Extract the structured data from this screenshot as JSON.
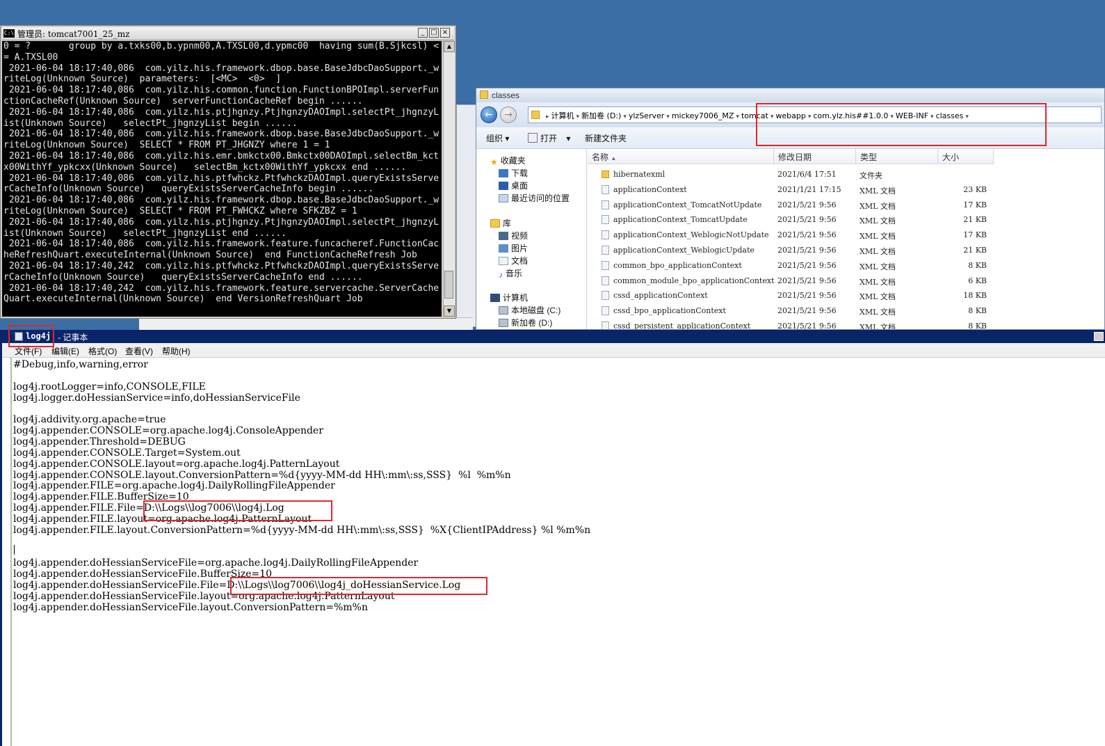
{
  "cmd": {
    "title": "管理员:  tomcat7001_25_mz",
    "icon": "C:\\",
    "lines": [
      "0 = ?       group by a.txks00,b.ypnm00,A.TXSL00,d.ypmc00  having sum(B.Sjkcsl) <",
      "= A.TXSL00",
      " 2021-06-04 18:17:40,086  com.yilz.his.framework.dbop.base.BaseJdbcDaoSupport._w",
      "riteLog(Unknown Source)  parameters:  [<MC>  <0>  ]",
      " 2021-06-04 18:17:40,086  com.yilz.his.common.function.FunctionBPOImpl.serverFun",
      "ctionCacheRef(Unknown Source)  serverFunctionCacheRef begin ......",
      " 2021-06-04 18:17:40,086  com.yilz.his.ptjhgnzy.PtjhgnzyDAOImpl.selectPt_jhgnzyL",
      "ist(Unknown Source)   selectPt_jhgnzyList begin ......",
      " 2021-06-04 18:17:40,086  com.yilz.his.framework.dbop.base.BaseJdbcDaoSupport._w",
      "riteLog(Unknown Source)  SELECT * FROM PT_JHGNZY where 1 = 1",
      " 2021-06-04 18:17:40,086  com.yilz.his.emr.bmkctx00.Bmkctx00DAOImpl.selectBm_kct",
      "x00WithYf_ypkcxx(Unknown Source)   selectBm_kctx00WithYf_ypkcxx end ......",
      " 2021-06-04 18:17:40,086  com.yilz.his.ptfwhckz.PtfwhckzDAOImpl.queryExistsServe",
      "rCacheInfo(Unknown Source)   queryExistsServerCacheInfo begin ......",
      " 2021-06-04 18:17:40,086  com.yilz.his.framework.dbop.base.BaseJdbcDaoSupport._w",
      "riteLog(Unknown Source)  SELECT * FROM PT_FWHCKZ where SFKZBZ = 1",
      " 2021-06-04 18:17:40,086  com.yilz.his.ptjhgnzy.PtjhgnzyDAOImpl.selectPt_jhgnzyL",
      "ist(Unknown Source)   selectPt_jhgnzyList end ......",
      " 2021-06-04 18:17:40,086  com.yilz.his.framework.feature.funcacheref.FunctionCac",
      "heRefreshQuart.executeInternal(Unknown Source)  end FunctionCacheRefresh Job",
      " 2021-06-04 18:17:40,242  com.yilz.his.ptfwhckz.PtfwhckzDAOImpl.queryExistsServe",
      "rCacheInfo(Unknown Source)   queryExistsServerCacheInfo end ......",
      " 2021-06-04 18:17:40,242  com.yilz.his.framework.feature.servercache.ServerCache",
      "Quart.executeInternal(Unknown Source)  end VersionRefreshQuart Job"
    ]
  },
  "explorer": {
    "title": "classes",
    "breadcrumbs": [
      "计算机",
      "新加卷 (D:)",
      "ylzServer",
      "mickey7006_MZ",
      "tomcat",
      "webapp",
      "com.ylz.his##1.0.0",
      "WEB-INF",
      "classes"
    ],
    "toolbar": {
      "organize": "组织",
      "open": "打开",
      "new_folder": "新建文件夹"
    },
    "nav": {
      "favorites": "收藏夹",
      "downloads": "下载",
      "desktop": "桌面",
      "recent": "最近访问的位置",
      "libraries": "库",
      "videos": "视频",
      "pictures": "图片",
      "documents": "文档",
      "music": "音乐",
      "computer": "计算机",
      "drive_c": "本地磁盘 (C:)",
      "drive_d": "新加卷 (D:)"
    },
    "columns": {
      "name": "名称",
      "date": "修改日期",
      "type": "类型",
      "size": "大小"
    },
    "files": [
      {
        "name": "hibernatexml",
        "date": "2021/6/4 17:51",
        "type": "文件夹",
        "size": "",
        "folder": true
      },
      {
        "name": "applicationContext",
        "date": "2021/1/21 17:15",
        "type": "XML 文档",
        "size": "23 KB"
      },
      {
        "name": "applicationContext_TomcatNotUpdate",
        "date": "2021/5/21 9:56",
        "type": "XML 文档",
        "size": "17 KB"
      },
      {
        "name": "applicationContext_TomcatUpdate",
        "date": "2021/5/21 9:56",
        "type": "XML 文档",
        "size": "21 KB"
      },
      {
        "name": "applicationContext_WeblogicNotUpdate",
        "date": "2021/5/21 9:56",
        "type": "XML 文档",
        "size": "17 KB"
      },
      {
        "name": "applicationContext_WeblogicUpdate",
        "date": "2021/5/21 9:56",
        "type": "XML 文档",
        "size": "21 KB"
      },
      {
        "name": "common_bpo_applicationContext",
        "date": "2021/5/21 9:56",
        "type": "XML 文档",
        "size": "8 KB"
      },
      {
        "name": "common_module_bpo_applicationContext",
        "date": "2021/5/21 9:56",
        "type": "XML 文档",
        "size": "6 KB"
      },
      {
        "name": "cssd_applicationContext",
        "date": "2021/5/21 9:56",
        "type": "XML 文档",
        "size": "18 KB"
      },
      {
        "name": "cssd_bpo_applicationContext",
        "date": "2021/5/21 9:56",
        "type": "XML 文档",
        "size": "8 KB"
      },
      {
        "name": "cssd_persistent_applicationContext",
        "date": "2021/5/21 9:56",
        "type": "XML 文档",
        "size": "8 KB"
      }
    ]
  },
  "notepad": {
    "filename": "log4j",
    "app": " - 记事本",
    "menu": [
      "文件(F)",
      "编辑(E)",
      "格式(O)",
      "查看(V)",
      "帮助(H)"
    ],
    "lines": [
      "#Debug,info,warning,error",
      "",
      "log4j.rootLogger=info,CONSOLE,FILE",
      "log4j.logger.doHessianService=info,doHessianServiceFile",
      "",
      "log4j.addivity.org.apache=true",
      "log4j.appender.CONSOLE=org.apache.log4j.ConsoleAppender",
      "log4j.appender.Threshold=DEBUG",
      "log4j.appender.CONSOLE.Target=System.out",
      "log4j.appender.CONSOLE.layout=org.apache.log4j.PatternLayout",
      "log4j.appender.CONSOLE.layout.ConversionPattern=%d{yyyy-MM-dd HH\\:mm\\:ss,SSS}  %l  %m%n",
      "log4j.appender.FILE=org.apache.log4j.DailyRollingFileAppender",
      "log4j.appender.FILE.BufferSize=10",
      "log4j.appender.FILE.File=D:\\\\Logs\\\\log7006\\\\log4j.Log",
      "log4j.appender.FILE.layout=org.apache.log4j.PatternLayout",
      "log4j.appender.FILE.layout.ConversionPattern=%d{yyyy-MM-dd HH\\:mm\\:ss,SSS}  %X{ClientIPAddress} %l %m%n",
      "",
      "",
      "log4j.appender.doHessianServiceFile=org.apache.log4j.DailyRollingFileAppender",
      "log4j.appender.doHessianServiceFile.BufferSize=10",
      "log4j.appender.doHessianServiceFile.File=D:\\\\Logs\\\\log7006\\\\log4j_doHessianService.Log",
      "log4j.appender.doHessianServiceFile.layout=org.apache.log4j.PatternLayout",
      "log4j.appender.doHessianServiceFile.layout.ConversionPattern=%m%n"
    ]
  },
  "colors": {
    "highlight": "#e0262e",
    "desktop": "#3a6ea5",
    "notepad_title": "#0a246a"
  }
}
